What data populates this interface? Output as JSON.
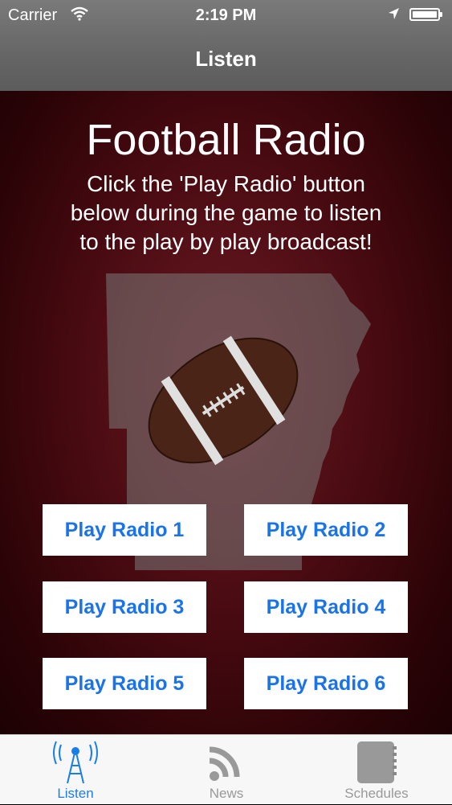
{
  "status_bar": {
    "carrier": "Carrier",
    "time": "2:19 PM"
  },
  "nav": {
    "title": "Listen"
  },
  "main": {
    "title": "Football Radio",
    "subtitle": "Click the 'Play Radio' button below during the game to listen to the play by play broadcast!"
  },
  "buttons": [
    {
      "label": "Play Radio 1"
    },
    {
      "label": "Play Radio 2"
    },
    {
      "label": "Play Radio 3"
    },
    {
      "label": "Play Radio 4"
    },
    {
      "label": "Play Radio 5"
    },
    {
      "label": "Play Radio 6"
    }
  ],
  "tabs": [
    {
      "label": "Listen",
      "icon": "radio-tower-icon",
      "active": true
    },
    {
      "label": "News",
      "icon": "rss-feed-icon",
      "active": false
    },
    {
      "label": "Schedules",
      "icon": "notebook-icon",
      "active": false
    }
  ],
  "colors": {
    "accent": "#1a73e8",
    "background": "#4a0b12",
    "nav_bar": "#6b6b6b"
  }
}
